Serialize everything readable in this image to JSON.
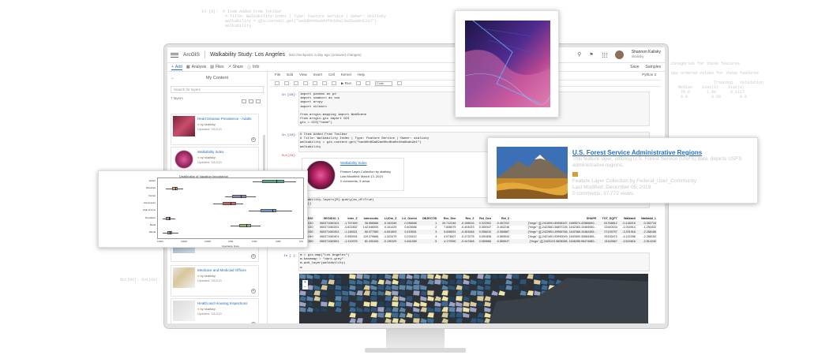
{
  "bg_code": {
    "top_cell": {
      "prompt": "In [9]:",
      "lines": [
        "# Item Added From Toolbar",
        "# Title: Walkability Index | Type: Feature Service | Owner: skalisky",
        "walkability = gis.content.get(\"aadd9949a8d4f0cb9a13ed3aa0c6333\")",
        "walkability"
      ]
    },
    "right_lines": [
      "categories for those features",
      "",
      "use ordered values for those features",
      "",
      "                  Training   Validation",
      "   Median    Stat(s)    Stat(s)",
      "    78.6       1.98      0.1127",
      "    0.0          0.50        0.0"
    ],
    "left_bottom": [
      "Out[88]: Out[69]:",
      "              ",
      "                      "
    ]
  },
  "app": {
    "brand": "ArcGIS",
    "notebook_title": "Walkability Study: Los Angeles",
    "checkpoint": "last checkpoint: a day ago (unsaved changes)",
    "user_name": "Shannon Kalisky",
    "user_handle": "skalisky",
    "tabs": [
      {
        "label": "Add",
        "icon": "plus-icon"
      },
      {
        "label": "Analysis",
        "icon": "analysis-icon"
      },
      {
        "label": "Files",
        "icon": "file-icon"
      },
      {
        "label": "Share",
        "icon": "share-icon"
      },
      {
        "label": "Info",
        "icon": "info-icon"
      }
    ],
    "right_actions": [
      "Save",
      "Samples"
    ]
  },
  "sidebar": {
    "title": "My Content",
    "search_placeholder": "Search for layers",
    "count": "7 layers",
    "layers": [
      {
        "title": "Heart Disease Prevalence - Adults",
        "by": "by skalisky",
        "updated": "Updated: 3/12/19"
      },
      {
        "title": "Walkability Index",
        "by": "by skalisky",
        "updated": "Updated: 3/12/19"
      },
      {
        "title": "",
        "by": "",
        "updated": "Updated: 3/12/19"
      },
      {
        "title": "Medicare and Medicaid Offices",
        "by": "by skalisky",
        "updated": "Updated: 3/12/19"
      },
      {
        "title": "Health and Housing Inspections",
        "by": "by skalisky",
        "updated": "Updated: 3/12/19"
      }
    ]
  },
  "notebook": {
    "menu": [
      "File",
      "Edit",
      "View",
      "Insert",
      "Cell",
      "Kernel",
      "Help"
    ],
    "kernel": "Python 3",
    "run_label": "Run",
    "cell_type": "Code",
    "cells": [
      {
        "prompt": "In [10]:",
        "lines": [
          "import pandas as pd",
          "import seaborn as sns",
          "import arcpy",
          "import sklearn",
          "",
          "from arcgis.mapping import WebScene",
          "from arcgis.gis import GIS",
          "gis = GIS(\"home\")"
        ]
      },
      {
        "prompt": "In [10]:",
        "lines": [
          "# Item Added From Toolbar",
          "# Title: Walkability Index | Type: Feature Service | Owner: skalisky",
          "walkability = gis.content.get(\"baddhh99a82ae0hc8ba5e2ea8bab2e1\")",
          "walkability"
        ]
      },
      {
        "prompt": "Out[10]:",
        "lines": []
      },
      {
        "prompt": "",
        "lines": [
          "walkability.layers[0].query(as_df=True)",
          "head()"
        ]
      },
      {
        "prompt": "In [ ]:",
        "lines": [
          "m = gis.map(\"Los Angeles\")",
          "m.basemap = \"dark-grey\"",
          "m.add_layer(walkability)",
          "m"
        ]
      }
    ],
    "output_card": {
      "title": "Walkability Index",
      "type": "Feature Layer Collection by skalisky",
      "modified": "Last Modified: March 13, 2019",
      "stats": "0 comments, 3 views"
    },
    "dataframe": {
      "columns": [
        "GEOID10",
        "GEOID10_1",
        "Inter_Z",
        "Intersectio",
        "LUOm_Z",
        "LU_Overal",
        "OBJECTID",
        "Res_Den",
        "Res_Z",
        "Ret_Den",
        "Ret_Z",
        "SHAPE",
        "TOT_SQFT",
        "Walkabil",
        "Walkabil_1"
      ],
      "rows": [
        [
          "06037106010",
          "060371060101",
          "-1.757469",
          "38.568586",
          "-0.163349",
          "0.256668",
          "1",
          "29.712246",
          "-0.158516",
          "0.322502",
          "-0.457202",
          "{\"rings\": [[[-2416091.89958167, 1669674.42585840...",
          "61768812",
          "-0.148216",
          "-0.352716"
        ],
        [
          "06037106020",
          "060371060201",
          "-0.822832",
          "142.546005",
          "0.161429",
          "0.403666",
          "2",
          "7.836079",
          "-0.404023",
          "0.360047",
          "-0.452246",
          "{\"rings\": [[[-2422681.36897226, 1642363.10484060...",
          "22440154",
          "-1.916914",
          "-1.291632"
        ],
        [
          "06037106030",
          "060371060301",
          "-1.145621",
          "66.977080",
          "-0.691803",
          "0.415551",
          "3",
          "5.836591",
          "-0.451648",
          "0.056010",
          "-0.565887",
          "{\"rings\": [[[-2422891.49966766, 1642368.10484365...",
          "27135797",
          "-3.391918",
          "-2.268186"
        ],
        [
          "06037106040",
          "060371060401",
          "-0.950934",
          "119.379686",
          "-1.323479",
          "0.224412",
          "4",
          "4.973607",
          "-0.473278",
          "0.051838",
          "-0.565944",
          "{\"rings\": [[[-2421451.93990049, 1643500.30684365...",
          "29130472",
          "-4.102266",
          "-2.266152"
        ],
        [
          "06037106050",
          "060371060501",
          "-1.310576",
          "81.430406",
          "-0.190329",
          "0.461389",
          "5",
          "4.172950",
          "-0.447468",
          "0.069666",
          "-0.565947",
          "{\"rings\": [[[-2420123.5808385, 1646285.98474680...",
          "41162667",
          "-3.524616",
          "-2.514240"
        ]
      ]
    }
  },
  "forest_card": {
    "title": "U.S. Forest Service Administrative Regions",
    "description": "This feature layer, utilizing U.S. Forest Service (USFS) data, depicts USFS administrative regions.",
    "type": "Feature Layer Collection by Federal_User_Community",
    "modified": "Last Modified: December 05, 2019",
    "stats": "0 comments, 37,772 views"
  },
  "boxplot": {
    "title": "Distribution of Vacation Importance",
    "xlabel": "Importance Score",
    "ticks": [
      "0.0001",
      "0.0002",
      "0.0005",
      "0.001",
      "0.002",
      "0.005",
      "0.01"
    ],
    "categories": [
      "Vacant",
      "Disturbed",
      "Owned",
      "Homeowner",
      "High Income",
      "Population",
      "Burial",
      "Rental"
    ],
    "colors": [
      "#4cae7f",
      "#d9a26a",
      "#8b82c2",
      "#d35b5b",
      "#6b9bd2",
      "#cc86c0",
      "#8dbb6b",
      "#9c9c9c"
    ]
  },
  "colors": {
    "accent": "#2a6ebb",
    "map_bg": "#2c3238",
    "monitor": "#e3e3e3"
  }
}
